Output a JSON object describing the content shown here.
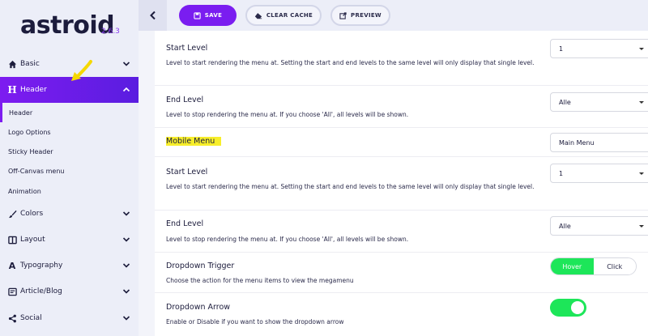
{
  "sidebar": {
    "logo": "astroid",
    "version": "2.6.3",
    "items": [
      {
        "label": "Basic",
        "icon": "home-icon"
      },
      {
        "label": "Header",
        "icon": "header-h-icon",
        "icon_glyph": "H"
      },
      {
        "label": "Colors",
        "icon": "brush-icon"
      },
      {
        "label": "Layout",
        "icon": "layout-icon"
      },
      {
        "label": "Typography",
        "icon": "typography-icon",
        "icon_glyph": "A"
      },
      {
        "label": "Article/Blog",
        "icon": "article-icon"
      },
      {
        "label": "Social",
        "icon": "share-icon"
      }
    ],
    "subitems": [
      {
        "label": "Header"
      },
      {
        "label": "Logo Options"
      },
      {
        "label": "Sticky Header"
      },
      {
        "label": "Off-Canvas menu"
      },
      {
        "label": "Animation"
      }
    ]
  },
  "toolbar": {
    "save_label": "SAVE",
    "clear_cache_label": "CLEAR CACHE",
    "preview_label": "PREVIEW"
  },
  "settings": {
    "start_level_1": {
      "title": "Start Level",
      "desc": "Level to start rendering the menu at. Setting the start and end levels to the same level will only display that single level.",
      "value": "1"
    },
    "end_level_1": {
      "title": "End Level",
      "desc": "Level to stop rendering the menu at. If you choose 'All', all levels will be shown.",
      "value": "Alle"
    },
    "mobile_menu": {
      "title": "Mobile Menu",
      "value": "Main Menu"
    },
    "start_level_2": {
      "title": "Start Level",
      "desc": "Level to start rendering the menu at. Setting the start and end levels to the same level will only display that single level.",
      "value": "1"
    },
    "end_level_2": {
      "title": "End Level",
      "desc": "Level to stop rendering the menu at. If you choose 'All', all levels will be shown.",
      "value": "Alle"
    },
    "dropdown_trigger": {
      "title": "Dropdown Trigger",
      "desc": "Choose the action for the menu items to view the megamenu",
      "options": [
        "Hover",
        "Click"
      ],
      "selected": "Hover"
    },
    "dropdown_arrow": {
      "title": "Dropdown Arrow",
      "desc": "Enable or Disable if you want to show the dropdown arrow",
      "enabled": true
    }
  },
  "colors": {
    "accent": "#7a1df0",
    "toggle_on": "#1de659",
    "highlight": "#f7ee2a",
    "annotation_arrow": "#f5d800"
  }
}
